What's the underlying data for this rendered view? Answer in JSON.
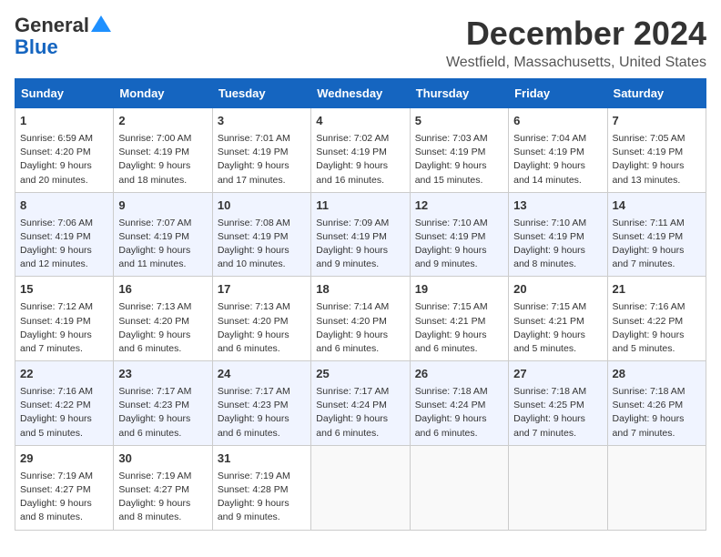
{
  "logo": {
    "line1": "General",
    "line2": "Blue"
  },
  "header": {
    "month": "December 2024",
    "location": "Westfield, Massachusetts, United States"
  },
  "weekdays": [
    "Sunday",
    "Monday",
    "Tuesday",
    "Wednesday",
    "Thursday",
    "Friday",
    "Saturday"
  ],
  "weeks": [
    [
      {
        "day": "1",
        "sunrise": "Sunrise: 6:59 AM",
        "sunset": "Sunset: 4:20 PM",
        "daylight": "Daylight: 9 hours and 20 minutes."
      },
      {
        "day": "2",
        "sunrise": "Sunrise: 7:00 AM",
        "sunset": "Sunset: 4:19 PM",
        "daylight": "Daylight: 9 hours and 18 minutes."
      },
      {
        "day": "3",
        "sunrise": "Sunrise: 7:01 AM",
        "sunset": "Sunset: 4:19 PM",
        "daylight": "Daylight: 9 hours and 17 minutes."
      },
      {
        "day": "4",
        "sunrise": "Sunrise: 7:02 AM",
        "sunset": "Sunset: 4:19 PM",
        "daylight": "Daylight: 9 hours and 16 minutes."
      },
      {
        "day": "5",
        "sunrise": "Sunrise: 7:03 AM",
        "sunset": "Sunset: 4:19 PM",
        "daylight": "Daylight: 9 hours and 15 minutes."
      },
      {
        "day": "6",
        "sunrise": "Sunrise: 7:04 AM",
        "sunset": "Sunset: 4:19 PM",
        "daylight": "Daylight: 9 hours and 14 minutes."
      },
      {
        "day": "7",
        "sunrise": "Sunrise: 7:05 AM",
        "sunset": "Sunset: 4:19 PM",
        "daylight": "Daylight: 9 hours and 13 minutes."
      }
    ],
    [
      {
        "day": "8",
        "sunrise": "Sunrise: 7:06 AM",
        "sunset": "Sunset: 4:19 PM",
        "daylight": "Daylight: 9 hours and 12 minutes."
      },
      {
        "day": "9",
        "sunrise": "Sunrise: 7:07 AM",
        "sunset": "Sunset: 4:19 PM",
        "daylight": "Daylight: 9 hours and 11 minutes."
      },
      {
        "day": "10",
        "sunrise": "Sunrise: 7:08 AM",
        "sunset": "Sunset: 4:19 PM",
        "daylight": "Daylight: 9 hours and 10 minutes."
      },
      {
        "day": "11",
        "sunrise": "Sunrise: 7:09 AM",
        "sunset": "Sunset: 4:19 PM",
        "daylight": "Daylight: 9 hours and 9 minutes."
      },
      {
        "day": "12",
        "sunrise": "Sunrise: 7:10 AM",
        "sunset": "Sunset: 4:19 PM",
        "daylight": "Daylight: 9 hours and 9 minutes."
      },
      {
        "day": "13",
        "sunrise": "Sunrise: 7:10 AM",
        "sunset": "Sunset: 4:19 PM",
        "daylight": "Daylight: 9 hours and 8 minutes."
      },
      {
        "day": "14",
        "sunrise": "Sunrise: 7:11 AM",
        "sunset": "Sunset: 4:19 PM",
        "daylight": "Daylight: 9 hours and 7 minutes."
      }
    ],
    [
      {
        "day": "15",
        "sunrise": "Sunrise: 7:12 AM",
        "sunset": "Sunset: 4:19 PM",
        "daylight": "Daylight: 9 hours and 7 minutes."
      },
      {
        "day": "16",
        "sunrise": "Sunrise: 7:13 AM",
        "sunset": "Sunset: 4:20 PM",
        "daylight": "Daylight: 9 hours and 6 minutes."
      },
      {
        "day": "17",
        "sunrise": "Sunrise: 7:13 AM",
        "sunset": "Sunset: 4:20 PM",
        "daylight": "Daylight: 9 hours and 6 minutes."
      },
      {
        "day": "18",
        "sunrise": "Sunrise: 7:14 AM",
        "sunset": "Sunset: 4:20 PM",
        "daylight": "Daylight: 9 hours and 6 minutes."
      },
      {
        "day": "19",
        "sunrise": "Sunrise: 7:15 AM",
        "sunset": "Sunset: 4:21 PM",
        "daylight": "Daylight: 9 hours and 6 minutes."
      },
      {
        "day": "20",
        "sunrise": "Sunrise: 7:15 AM",
        "sunset": "Sunset: 4:21 PM",
        "daylight": "Daylight: 9 hours and 5 minutes."
      },
      {
        "day": "21",
        "sunrise": "Sunrise: 7:16 AM",
        "sunset": "Sunset: 4:22 PM",
        "daylight": "Daylight: 9 hours and 5 minutes."
      }
    ],
    [
      {
        "day": "22",
        "sunrise": "Sunrise: 7:16 AM",
        "sunset": "Sunset: 4:22 PM",
        "daylight": "Daylight: 9 hours and 5 minutes."
      },
      {
        "day": "23",
        "sunrise": "Sunrise: 7:17 AM",
        "sunset": "Sunset: 4:23 PM",
        "daylight": "Daylight: 9 hours and 6 minutes."
      },
      {
        "day": "24",
        "sunrise": "Sunrise: 7:17 AM",
        "sunset": "Sunset: 4:23 PM",
        "daylight": "Daylight: 9 hours and 6 minutes."
      },
      {
        "day": "25",
        "sunrise": "Sunrise: 7:17 AM",
        "sunset": "Sunset: 4:24 PM",
        "daylight": "Daylight: 9 hours and 6 minutes."
      },
      {
        "day": "26",
        "sunrise": "Sunrise: 7:18 AM",
        "sunset": "Sunset: 4:24 PM",
        "daylight": "Daylight: 9 hours and 6 minutes."
      },
      {
        "day": "27",
        "sunrise": "Sunrise: 7:18 AM",
        "sunset": "Sunset: 4:25 PM",
        "daylight": "Daylight: 9 hours and 7 minutes."
      },
      {
        "day": "28",
        "sunrise": "Sunrise: 7:18 AM",
        "sunset": "Sunset: 4:26 PM",
        "daylight": "Daylight: 9 hours and 7 minutes."
      }
    ],
    [
      {
        "day": "29",
        "sunrise": "Sunrise: 7:19 AM",
        "sunset": "Sunset: 4:27 PM",
        "daylight": "Daylight: 9 hours and 8 minutes."
      },
      {
        "day": "30",
        "sunrise": "Sunrise: 7:19 AM",
        "sunset": "Sunset: 4:27 PM",
        "daylight": "Daylight: 9 hours and 8 minutes."
      },
      {
        "day": "31",
        "sunrise": "Sunrise: 7:19 AM",
        "sunset": "Sunset: 4:28 PM",
        "daylight": "Daylight: 9 hours and 9 minutes."
      },
      null,
      null,
      null,
      null
    ]
  ]
}
